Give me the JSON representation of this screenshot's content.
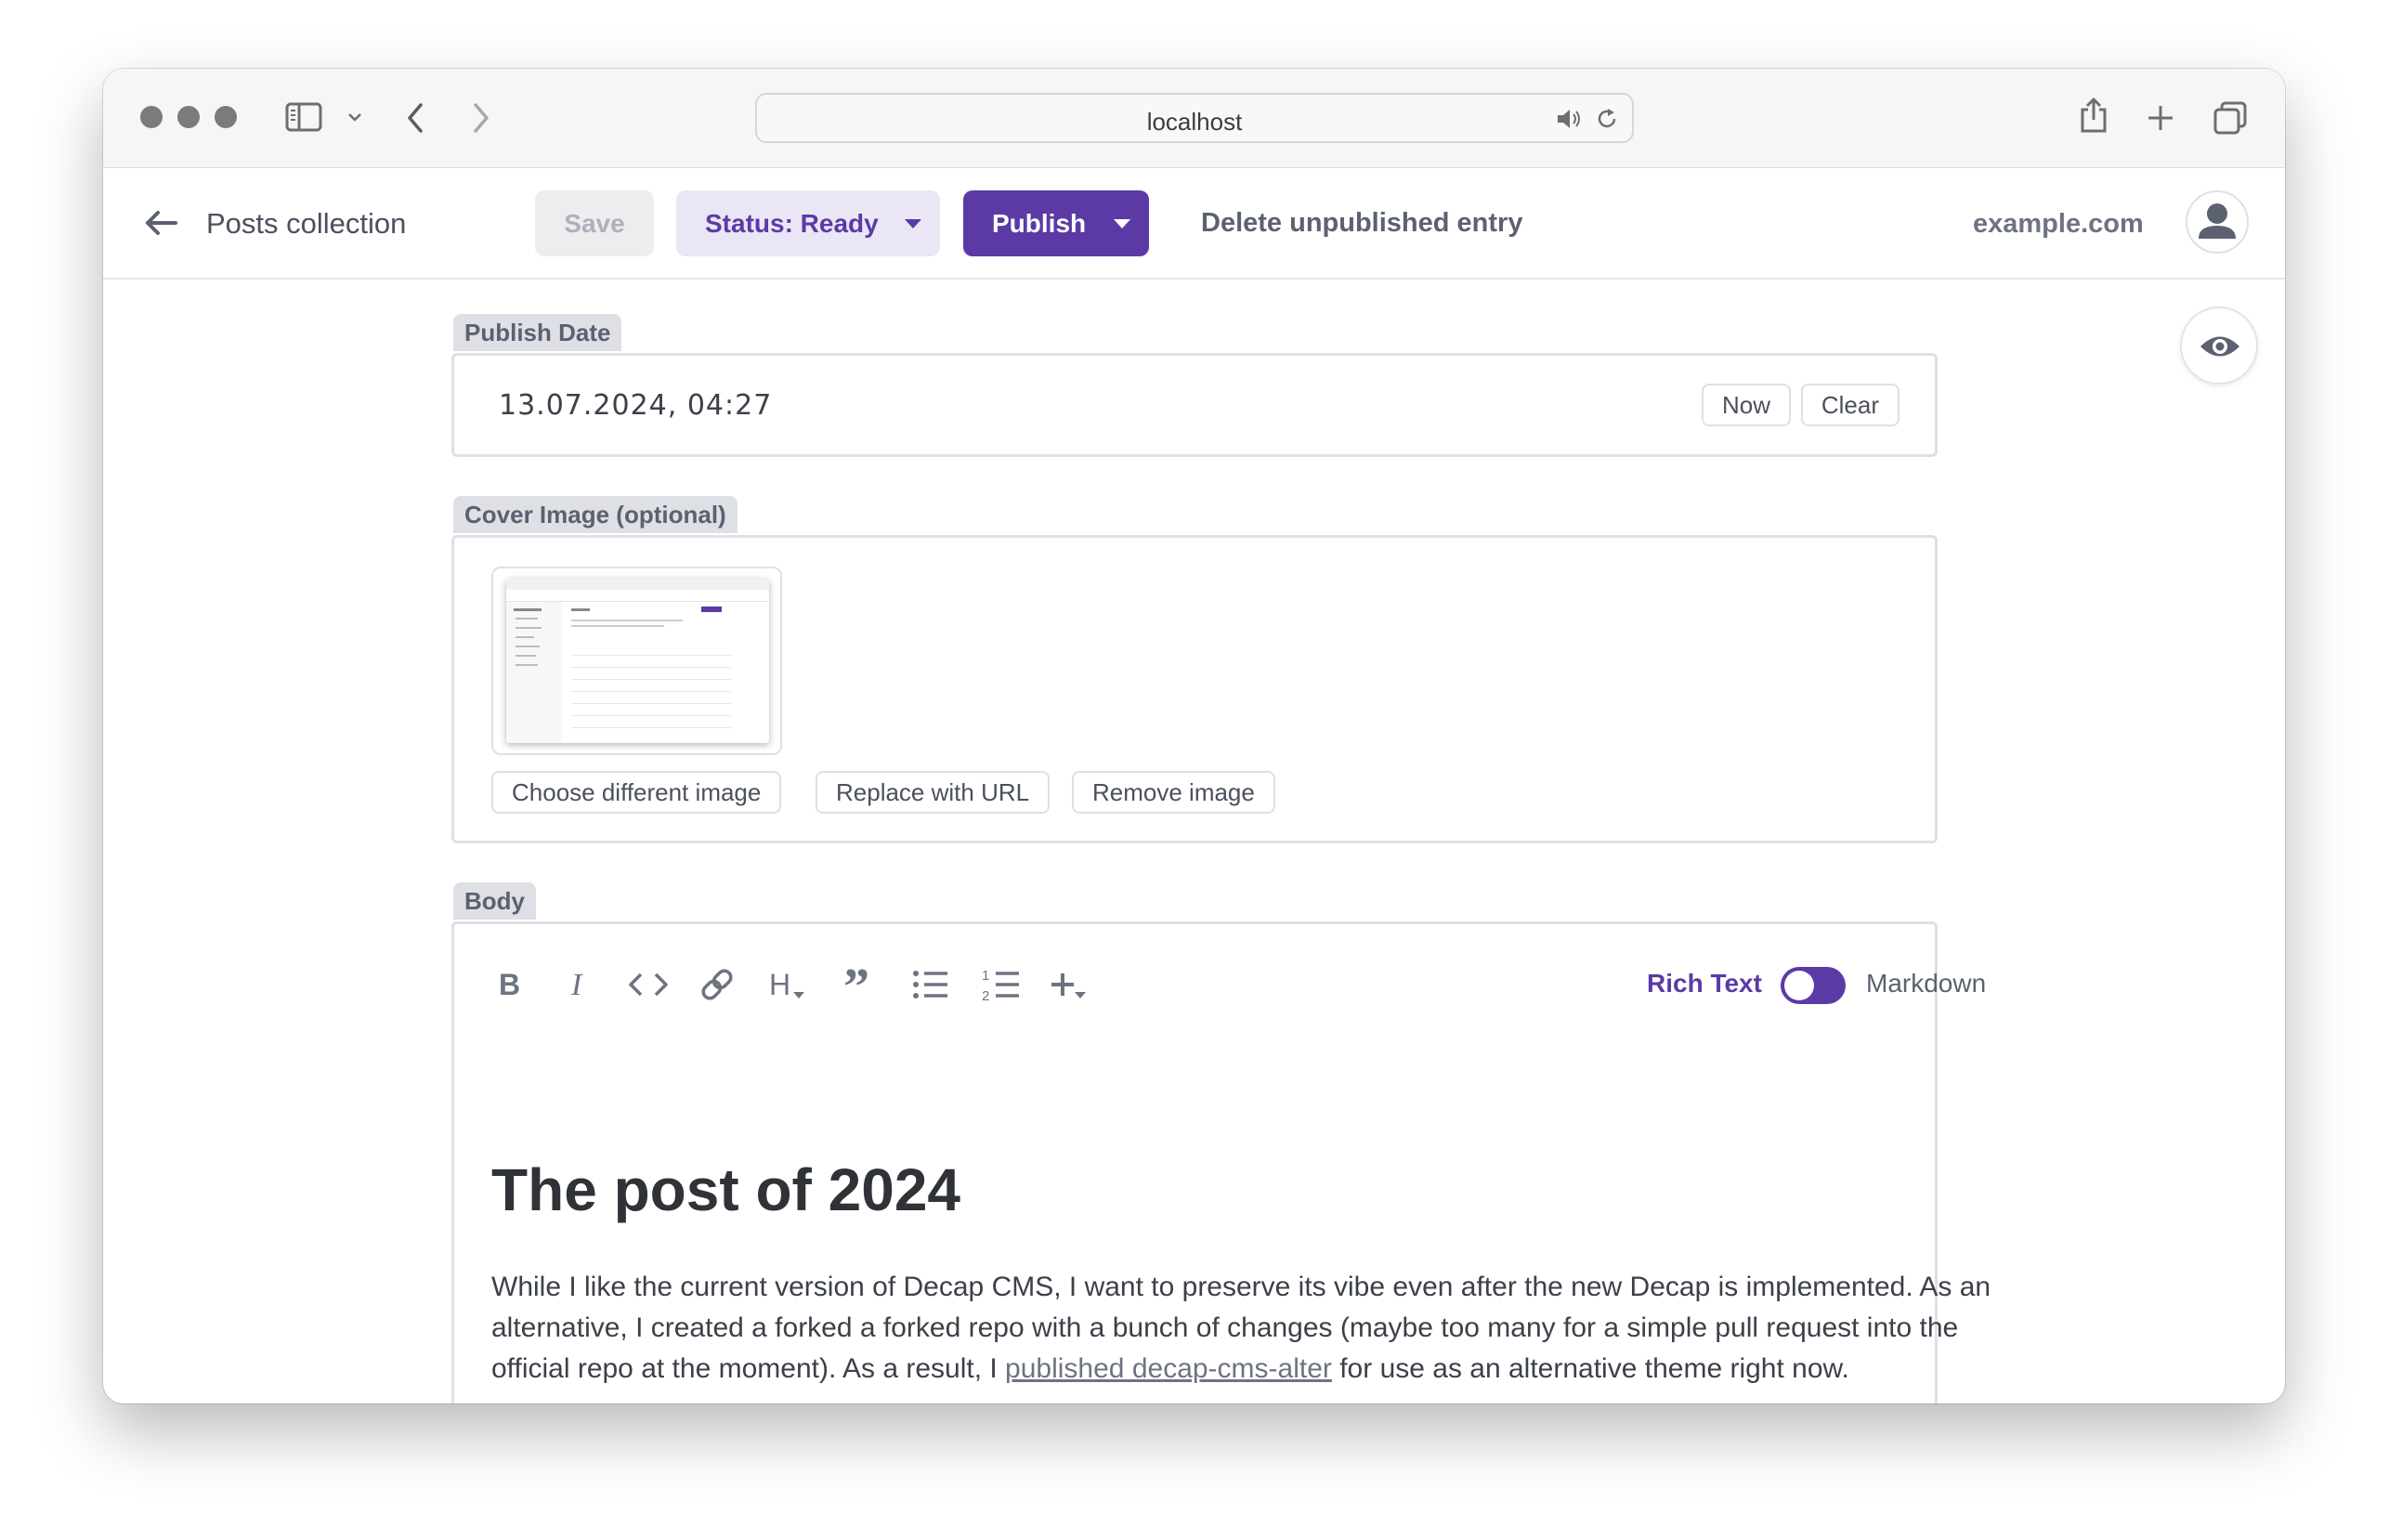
{
  "browser": {
    "url": "localhost",
    "icons": [
      "close-dot",
      "minimize-dot",
      "zoom-dot",
      "sidebar-icon",
      "chevron-down-icon",
      "back-arrow-icon",
      "forward-arrow-icon",
      "speaker-icon",
      "reload-icon",
      "share-icon",
      "plus-icon",
      "tabs-icon"
    ]
  },
  "topbar": {
    "back_label": "Posts collection",
    "save_label": "Save",
    "status_label": "Status: Ready",
    "publish_label": "Publish",
    "delete_label": "Delete unpublished entry",
    "site_label": "example.com"
  },
  "fields": {
    "publish_date": {
      "label": "Publish Date",
      "value": "13.07.2024, 04:27",
      "now_label": "Now",
      "clear_label": "Clear"
    },
    "cover_image": {
      "label": "Cover Image (optional)",
      "choose_label": "Choose different image",
      "replace_label": "Replace with URL",
      "remove_label": "Remove image"
    },
    "body": {
      "label": "Body",
      "toolbar_icons": [
        "bold-icon",
        "italic-icon",
        "code-icon",
        "link-icon",
        "heading-icon",
        "quote-icon",
        "bulleted-list-icon",
        "numbered-list-icon",
        "add-component-icon"
      ],
      "mode_rich": "Rich Text",
      "mode_markdown": "Markdown",
      "heading": "The post of 2024",
      "para_before": "While I like the current version of Decap CMS, I want to preserve its vibe even after the new Decap is implemented. As an alternative, I created a forked a forked repo with a bunch of changes (maybe too many for a simple pull request into the  official repo at the moment). As a result, I ",
      "para_link": "published decap-cms-alter",
      "para_after": " for use as an alternative theme right now."
    }
  },
  "colors": {
    "accent": "#5b3aa6",
    "accent_light": "#ebe6f5",
    "label_bg": "#dfe0e6",
    "text": "#3a3f4b"
  }
}
